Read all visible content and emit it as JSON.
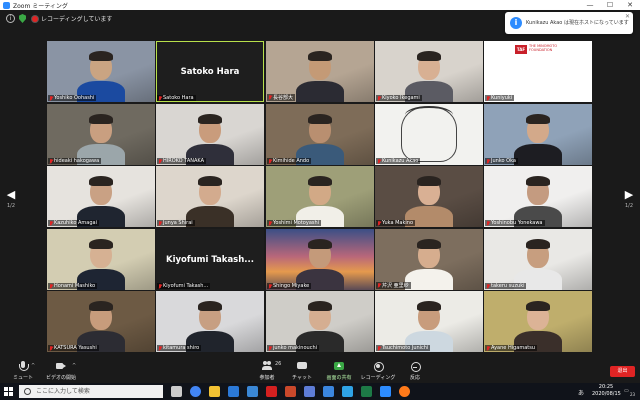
{
  "titlebar": {
    "app_title": "Zoom ミーティング",
    "min": "—",
    "max": "☐",
    "close": "✕"
  },
  "topbar": {
    "recording_status": "レコーディングしています"
  },
  "notification": {
    "text": "Kunikazu Akao は現在ホストになっています",
    "icon": "info-icon",
    "close": "✕"
  },
  "pager": {
    "prev_label": "◀",
    "prev_page": "1/2",
    "next_label": "▶",
    "next_page": "1/2"
  },
  "participants": [
    {
      "name": "Yoshiko Oohashi",
      "type": "video",
      "bg": "#8a94a4",
      "face": "#caa482",
      "shirt": "#1b4aa0"
    },
    {
      "name": "Satoko Hara",
      "type": "name_only",
      "active": true
    },
    {
      "name": "長谷部大",
      "type": "video",
      "bg": "#b5a593",
      "face": "#c49a76",
      "shirt": "#2b2b33"
    },
    {
      "name": "Kiyoko Ikegami",
      "type": "video",
      "bg": "#d8d3cc",
      "face": "#d8b093",
      "shirt": "#5b5b63"
    },
    {
      "name": "Kuniyuki",
      "type": "logo",
      "logo_tag": "TAF",
      "logo_text": "THE MINOMOTO FOUNDATION",
      "bg": "#ffffff"
    },
    {
      "name": "hideaki hakogawa",
      "type": "video",
      "bg": "#6f6a60",
      "face": "#c99f80",
      "shirt": "#9ba6aa"
    },
    {
      "name": "HIROKO TANAKA",
      "type": "video",
      "bg": "#d9d6d2",
      "face": "#c99c7c",
      "shirt": "#2f2f3a"
    },
    {
      "name": "Kimihide Ando",
      "type": "video",
      "bg": "#7e6c58",
      "face": "#b98f70",
      "shirt": "#3a5a7a"
    },
    {
      "name": "Kunikazu Akao",
      "type": "sketch",
      "bg": "#f2f2ef"
    },
    {
      "name": "Junko Oka",
      "type": "video",
      "bg": "#8fa2b8",
      "face": "#d3a98a",
      "shirt": "#1d1d22"
    },
    {
      "name": "Kazuhiko Amagai",
      "type": "video",
      "bg": "#e6e3de",
      "face": "#c9a184",
      "shirt": "#1f2530"
    },
    {
      "name": "Junya Shirai",
      "type": "video",
      "bg": "#ddd6cc",
      "face": "#d3ab8e",
      "shirt": "#3a3027"
    },
    {
      "name": "Yoshimi Motoyashi",
      "type": "video",
      "bg": "#9e9f78",
      "face": "#d2a986",
      "shirt": "#f1efe8"
    },
    {
      "name": "Yuka Makino",
      "type": "video",
      "bg": "#5a4d44",
      "face": "#d9b094",
      "shirt": "#b38b6a"
    },
    {
      "name": "Yoshinobu Yonekawa",
      "type": "video",
      "bg": "#f0efee",
      "face": "#c49b80",
      "shirt": "#4a4a4a"
    },
    {
      "name": "Honami Mashiko",
      "type": "video",
      "bg": "#d3cdb2",
      "face": "#d6b193",
      "shirt": "#1e2533"
    },
    {
      "name": "Kiyofumi Takash...",
      "type": "name_only"
    },
    {
      "name": "Shingo Miyake",
      "type": "sunset",
      "bg": "#c0705a",
      "face": "#c49a7a",
      "shirt": "#3b3440"
    },
    {
      "name": "芹沢 亜里紗",
      "type": "video",
      "bg": "#7d6e5e",
      "face": "#d6ad8e",
      "shirt": "#f4f2ec"
    },
    {
      "name": "takeru suzuki",
      "type": "video",
      "bg": "#e9e8e5",
      "face": "#c79e7f",
      "shirt": "#e8e8e8"
    },
    {
      "name": "KATSURA Yasushi",
      "type": "video",
      "bg": "#6d5a44",
      "face": "#c79c7c",
      "shirt": "#2c2c33"
    },
    {
      "name": "kitamura shiro",
      "type": "video",
      "bg": "#d9d9db",
      "face": "#c79f82",
      "shirt": "#20242c"
    },
    {
      "name": "junko makinouchi",
      "type": "video",
      "bg": "#cfcdc8",
      "face": "#d5ae91",
      "shirt": "#2a2a2a"
    },
    {
      "name": "Tsuchimoto Junichi",
      "type": "video",
      "bg": "#ecebe6",
      "face": "#c89c7c",
      "shirt": "#cdd8e0"
    },
    {
      "name": "Ayane Higamatsu",
      "type": "video",
      "bg": "#bfae6c",
      "face": "#dcb396",
      "shirt": "#3a2f2a"
    }
  ],
  "toolbar": {
    "mute": "ミュート",
    "video_stop": "ビデオの開始",
    "participants": "参加者",
    "participants_count": "26",
    "chat": "チャット",
    "share": "画面の共有",
    "record": "レコーディング",
    "reactions": "反応",
    "end": "退出"
  },
  "taskbar": {
    "search_placeholder": "ここに入力して検索",
    "time": "20:25",
    "date": "2020/08/15",
    "ime": "あ",
    "notifications_count": "23",
    "apps": [
      "task-view",
      "chrome",
      "file-explorer",
      "mail",
      "store",
      "acrobat",
      "powerpoint",
      "photos",
      "onedrive",
      "edge",
      "excel",
      "zoom",
      "firefox"
    ],
    "app_colors": [
      "#cccccc",
      "#4285f4",
      "#f2c233",
      "#2b79d8",
      "#3a87d6",
      "#d42020",
      "#c9482b",
      "#5e7dd8",
      "#3b86e0",
      "#2fa3e6",
      "#1d7a46",
      "#2d8cff",
      "#ff7a1a"
    ]
  }
}
